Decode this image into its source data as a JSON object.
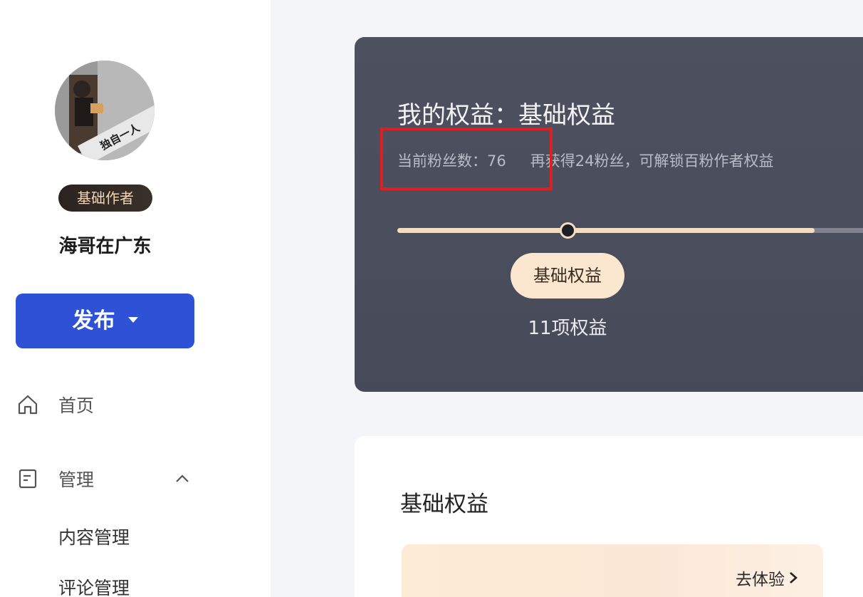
{
  "sidebar": {
    "badge": "基础作者",
    "username": "海哥在广东",
    "avatar_caption": "独自一人",
    "publish_label": "发布",
    "nav": {
      "home": "首页",
      "manage": "管理"
    },
    "sub_items": [
      "内容管理",
      "评论管理"
    ]
  },
  "hero": {
    "title": "我的权益：基础权益",
    "fans_label": "当前粉丝数：76",
    "unlock_hint": "再获得24粉丝，可解锁百粉作者权益",
    "progress": 0.76,
    "tier_label": "基础权益",
    "tier_count": "11项权益"
  },
  "card": {
    "title": "基础权益",
    "try_label": "去体验"
  },
  "colors": {
    "primary": "#2f51d6",
    "hero_bg": "#4a4e5c",
    "accent_gold": "#f3dcbf",
    "highlight": "#e02020"
  }
}
